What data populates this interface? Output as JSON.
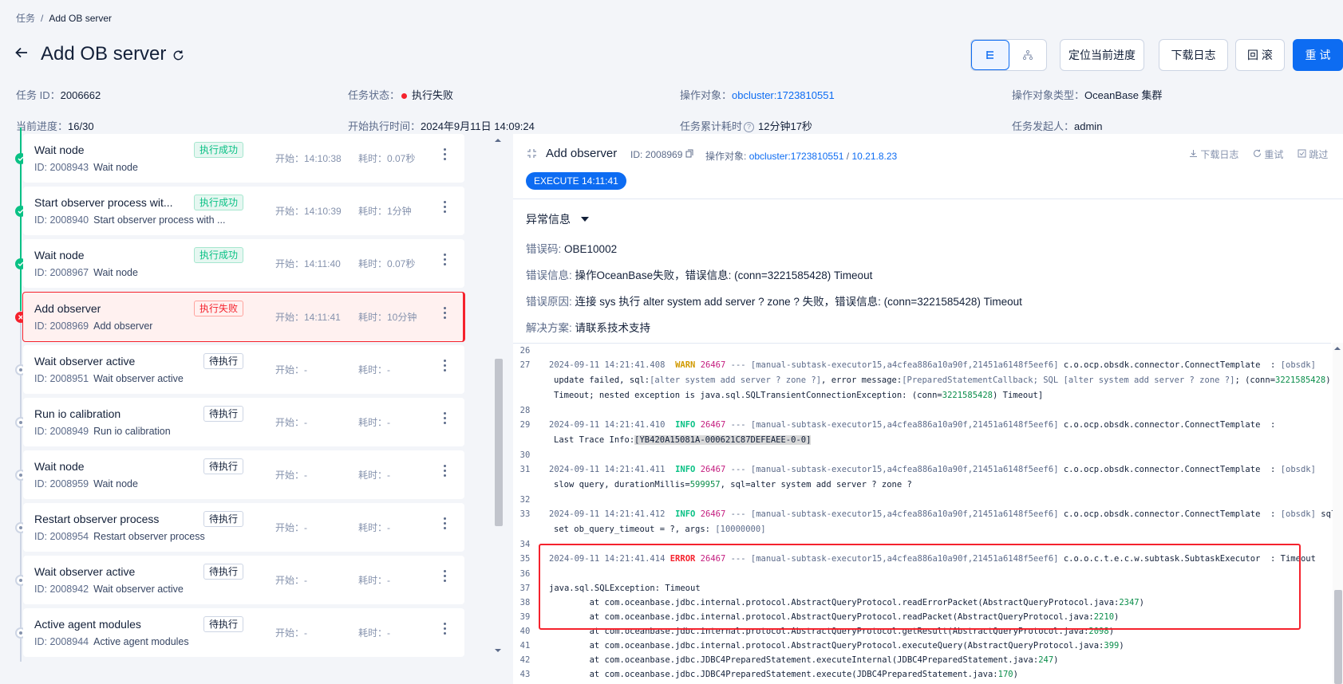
{
  "breadcrumb": {
    "root": "任务",
    "sep": "/",
    "current": "Add OB server"
  },
  "header": {
    "title": "Add OB server"
  },
  "actions": {
    "locate": "定位当前进度",
    "download": "下载日志",
    "rollback": "回 滚",
    "retry": "重 试"
  },
  "info": {
    "task_id_label": "任务 ID：",
    "task_id": "2006662",
    "status_label": "任务状态：",
    "status": "执行失败",
    "target_label": "操作对象：",
    "target": "obcluster:1723810551",
    "target_type_label": "操作对象类型：",
    "target_type": "OceanBase 集群",
    "progress_label": "当前进度：",
    "progress": "16/30",
    "start_label": "开始执行时间：",
    "start": "2024年9月11日 14:09:24",
    "elapsed_label": "任务累计耗时",
    "elapsed": "12分钟17秒",
    "creator_label": "任务发起人：",
    "creator": "admin"
  },
  "subtasks": [
    {
      "name": "Wait node",
      "id": "ID: 2008943",
      "sub": "Wait node",
      "tag": "执行成功",
      "start": "开始：14:10:38",
      "cost": "耗时：0.07秒"
    },
    {
      "name": "Start observer process wit...",
      "id": "ID: 2008940",
      "sub": "Start observer process with ...",
      "tag": "执行成功",
      "start": "开始：14:10:39",
      "cost": "耗时：1分钟"
    },
    {
      "name": "Wait node",
      "id": "ID: 2008967",
      "sub": "Wait node",
      "tag": "执行成功",
      "start": "开始：14:11:40",
      "cost": "耗时：0.07秒"
    },
    {
      "name": "Add observer",
      "id": "ID: 2008969",
      "sub": "Add observer",
      "tag": "执行失败",
      "start": "开始：14:11:41",
      "cost": "耗时：10分钟"
    },
    {
      "name": "Wait observer active",
      "id": "ID: 2008951",
      "sub": "Wait observer active",
      "tag": "待执行",
      "start": "开始：-",
      "cost": "耗时：-"
    },
    {
      "name": "Run io calibration",
      "id": "ID: 2008949",
      "sub": "Run io calibration",
      "tag": "待执行",
      "start": "开始：-",
      "cost": "耗时：-"
    },
    {
      "name": "Wait node",
      "id": "ID: 2008959",
      "sub": "Wait node",
      "tag": "待执行",
      "start": "开始：-",
      "cost": "耗时：-"
    },
    {
      "name": "Restart observer process",
      "id": "ID: 2008954",
      "sub": "Restart observer process",
      "tag": "待执行",
      "start": "开始：-",
      "cost": "耗时：-"
    },
    {
      "name": "Wait observer active",
      "id": "ID: 2008942",
      "sub": "Wait observer active",
      "tag": "待执行",
      "start": "开始：-",
      "cost": "耗时：-"
    },
    {
      "name": "Active agent modules",
      "id": "ID: 2008944",
      "sub": "Active agent modules",
      "tag": "待执行",
      "start": "开始：-",
      "cost": "耗时：-"
    }
  ],
  "detail": {
    "title": "Add observer",
    "id": "ID: 2008969",
    "target_label": "操作对象:",
    "target_cluster": "obcluster:1723810551",
    "target_sep": "/",
    "target_ip": "10.21.8.23",
    "download": "下载日志",
    "retry": "重试",
    "skip": "跳过",
    "exec_badge": "EXECUTE 14:11:41",
    "exception_title": "异常信息",
    "error_code_label": "错误码:",
    "error_code": "OBE10002",
    "error_msg_label": "错误信息:",
    "error_msg": "操作OceanBase失败，错误信息: (conn=3221585428) Timeout",
    "error_cause_label": "错误原因:",
    "error_cause": "连接 sys 执行 alter system add server ? zone ? 失败，错误信息: (conn=3221585428) Timeout",
    "solution_label": "解决方案:",
    "solution": "请联系技术支持"
  },
  "log": {
    "l26": "26",
    "l27": "27",
    "l27_ts": "2024-09-11 14:21:41.408",
    "l27_lvl": "WARN",
    "l27_pid": "26467",
    "l27_thread": " --- [manual-subtask-executor15,a4cfea886a10a90f,21451a6148f5eef6]",
    "l27_cls": " c.o.ocp.obsdk.connector.ConnectTemplate  : ",
    "l27_tag": "[obsdk]",
    "l27b": "update failed, sql:",
    "l27b_sql": "[alter system add server ? zone ?]",
    "l27b_m": ", error message:",
    "l27b_err": "[PreparedStatementCallback; SQL [alter system add server ? zone ?]",
    "l27b_conn": "; (conn=",
    "l27b_cn": "3221585428",
    "l27b_end": ")",
    "l27c": "Timeout; nested exception is java.sql.SQLTransientConnectionException: (conn=",
    "l27c_cn": "3221585428",
    "l27c_end": ") Timeout]",
    "l28": "28",
    "l29": "29",
    "l29_ts": "2024-09-11 14:21:41.410",
    "l29_lvl": "INFO",
    "l29_pid": "26467",
    "l29_thread": " --- [manual-subtask-executor15,a4cfea886a10a90f,21451a6148f5eef6]",
    "l29_cls": " c.o.ocp.obsdk.connector.ConnectTemplate  :",
    "l29b": "Last Trace Info:",
    "l29b_id": "[YB420A15081A-000621C87DEFEAEE-0-0]",
    "l30": "30",
    "l31": "31",
    "l31_ts": "2024-09-11 14:21:41.411",
    "l31_lvl": "INFO",
    "l31_pid": "26467",
    "l31_thread": " --- [manual-subtask-executor15,a4cfea886a10a90f,21451a6148f5eef6]",
    "l31_cls": " c.o.ocp.obsdk.connector.ConnectTemplate  : ",
    "l31_tag": "[obsdk]",
    "l31b": "slow query, durationMillis=",
    "l31b_n": "599957",
    "l31b_end": ", sql=alter system add server ? zone ?",
    "l32": "32",
    "l33": "33",
    "l33_ts": "2024-09-11 14:21:41.412",
    "l33_lvl": "INFO",
    "l33_pid": "26467",
    "l33_thread": " --- [manual-subtask-executor15,a4cfea886a10a90f,21451a6148f5eef6]",
    "l33_cls": " c.o.ocp.obsdk.connector.ConnectTemplate  : ",
    "l33_tag": "[obsdk]",
    "l33_sql": " sql:",
    "l33b": "set ob_query_timeout = ?, args: ",
    "l33b_a": "[10000000]",
    "l34": "34",
    "l35": "35",
    "l35_ts": "2024-09-11 14:21:41.414",
    "l35_lvl": "ERROR",
    "l35_pid": "26467",
    "l35_thread": " --- [manual-subtask-executor15,a4cfea886a10a90f,21451a6148f5eef6]",
    "l35_cls": " c.o.o.c.t.e.c.w.subtask.SubtaskExecutor  : Timeout",
    "l36": "36",
    "l37": "37",
    "l37_t": "java.sql.SQLException: Timeout",
    "l38": "38",
    "l38_t": "        at com.oceanbase.jdbc.internal.protocol.AbstractQueryProtocol.readErrorPacket(AbstractQueryProtocol.java:",
    "l38_n": "2347",
    "l38_e": ")",
    "l39": "39",
    "l39_t": "        at com.oceanbase.jdbc.internal.protocol.AbstractQueryProtocol.readPacket(AbstractQueryProtocol.java:",
    "l39_n": "2210",
    "l39_e": ")",
    "l40": "40",
    "l40_t": "        at com.oceanbase.jdbc.internal.protocol.AbstractQueryProtocol.getResult(AbstractQueryProtocol.java:",
    "l40_n": "2098",
    "l40_e": ")",
    "l41": "41",
    "l41_t": "        at com.oceanbase.jdbc.internal.protocol.AbstractQueryProtocol.executeQuery(AbstractQueryProtocol.java:",
    "l41_n": "399",
    "l41_e": ")",
    "l42": "42",
    "l42_t": "        at com.oceanbase.jdbc.JDBC4PreparedStatement.executeInternal(JDBC4PreparedStatement.java:",
    "l42_n": "247",
    "l42_e": ")",
    "l43": "43",
    "l43_t": "        at com.oceanbase.jdbc.JDBC4PreparedStatement.execute(JDBC4PreparedStatement.java:",
    "l43_n": "170",
    "l43_e": ")"
  }
}
